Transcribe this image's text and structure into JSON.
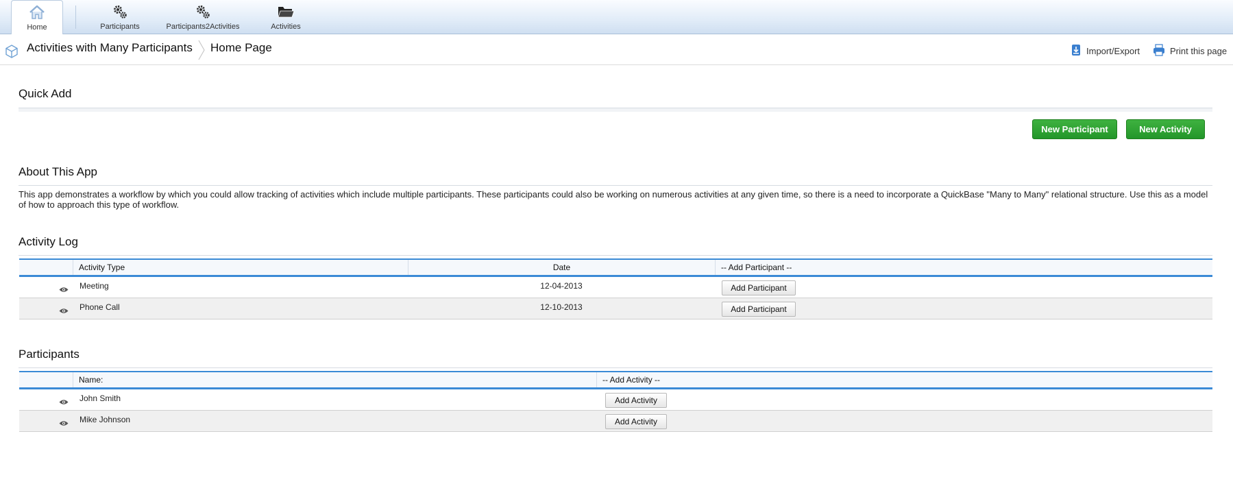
{
  "nav": {
    "tabs": [
      {
        "label": "Home",
        "icon": "home-icon"
      },
      {
        "label": "Participants",
        "icon": "gears-icon"
      },
      {
        "label": "Participants2Activities",
        "icon": "gears-icon"
      },
      {
        "label": "Activities",
        "icon": "folder-icon"
      }
    ]
  },
  "breadcrumb": {
    "app_name": "Activities with Many Participants",
    "page_name": "Home Page"
  },
  "toolbar": {
    "import_export": "Import/Export",
    "print": "Print this page"
  },
  "quick_add": {
    "title": "Quick Add",
    "new_participant": "New Participant",
    "new_activity": "New Activity"
  },
  "about": {
    "title": "About This App",
    "text": "This app demonstrates a workflow by which you could allow tracking of activities which include multiple participants. These participants could also be working on numerous activities at any given time, so there is a need to incorporate a QuickBase \"Many to Many\" relational structure.  Use this as a model of how to approach this type of workflow."
  },
  "activity_log": {
    "title": "Activity Log",
    "headers": [
      "Activity Type",
      "Date",
      "-- Add Participant --"
    ],
    "rows": [
      {
        "type": "Meeting",
        "date": "12-04-2013",
        "action": "Add Participant"
      },
      {
        "type": "Phone Call",
        "date": "12-10-2013",
        "action": "Add Participant"
      }
    ]
  },
  "participants": {
    "title": "Participants",
    "headers": [
      "Name:",
      "-- Add Activity --"
    ],
    "rows": [
      {
        "name": "John Smith",
        "action": "Add Activity"
      },
      {
        "name": "Mike Johnson",
        "action": "Add Activity"
      }
    ]
  },
  "colors": {
    "accent_blue": "#3a8ad6",
    "button_green": "#23962a"
  }
}
